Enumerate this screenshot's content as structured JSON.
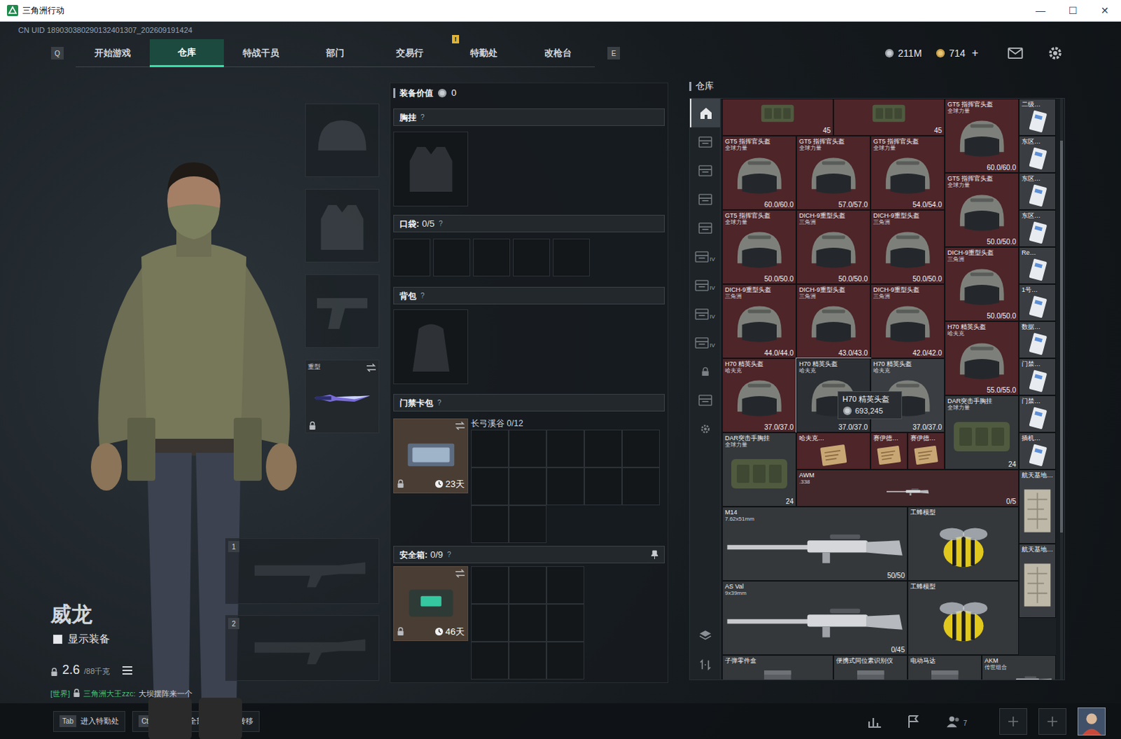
{
  "window": {
    "title": "三角洲行动",
    "controls": [
      "—",
      "☐",
      "✕"
    ]
  },
  "uid": "CN UID 189030380290132401307_202609191424",
  "nav": {
    "prev_key": "Q",
    "next_key": "E",
    "tabs": [
      {
        "label": "开始游戏",
        "selected": false,
        "badge": ""
      },
      {
        "label": "仓库",
        "selected": true,
        "badge": ""
      },
      {
        "label": "特战干员",
        "selected": false,
        "badge": ""
      },
      {
        "label": "部门",
        "selected": false,
        "badge": ""
      },
      {
        "label": "交易行",
        "selected": false,
        "badge": ""
      },
      {
        "label": "特勤处",
        "selected": false,
        "badge": "!"
      },
      {
        "label": "改枪台",
        "selected": false,
        "badge": ""
      }
    ]
  },
  "currency": {
    "coins": "211M",
    "tokens": "714",
    "add": "+"
  },
  "character": {
    "name": "威龙",
    "show_gear": {
      "label": "显示装备",
      "checked": false
    },
    "weight": "2.6",
    "capacity": "/88千克"
  },
  "chat": {
    "channel": "[世界]",
    "sender": "三角洲大王zzc:",
    "message": "大坝摆阵来一个"
  },
  "gear_slots": [
    {
      "kind": "helmet",
      "label": "",
      "filled": false,
      "locked": false
    },
    {
      "kind": "armor",
      "label": "",
      "filled": false,
      "locked": false
    },
    {
      "kind": "pistol",
      "label": "",
      "filled": false,
      "locked": false
    },
    {
      "kind": "melee",
      "label": "重型",
      "filled": true,
      "locked": true
    }
  ],
  "weapon_slots": [
    {
      "number": "1"
    },
    {
      "number": "2"
    }
  ],
  "loadout": {
    "value_label": "装备价值",
    "value": "0",
    "chest": {
      "title": "胸挂",
      "help": "?"
    },
    "pockets": {
      "title": "口袋:",
      "count": "0/5",
      "help": "?",
      "cells": 5
    },
    "backpack": {
      "title": "背包",
      "help": "?"
    },
    "keycard": {
      "title": "门禁卡包",
      "help": "?",
      "days": "23天",
      "locked": true,
      "map": "长弓溪谷",
      "count": "0/12",
      "cells": 12
    },
    "safebox": {
      "title": "安全箱:",
      "count": "0/9",
      "help": "?",
      "days": "46天",
      "locked": true,
      "cells": 9
    }
  },
  "warehouse": {
    "title": "仓库",
    "side_tabs": [
      {
        "kind": "home",
        "tier": "",
        "selected": true
      },
      {
        "kind": "cabinet",
        "tier": "",
        "selected": false
      },
      {
        "kind": "cabinet",
        "tier": "",
        "selected": false
      },
      {
        "kind": "cabinet",
        "tier": "",
        "selected": false
      },
      {
        "kind": "cabinet",
        "tier": "",
        "selected": false
      },
      {
        "kind": "cabinet",
        "tier": "IV",
        "selected": false
      },
      {
        "kind": "cabinet",
        "tier": "IV",
        "selected": false
      },
      {
        "kind": "cabinet",
        "tier": "IV",
        "selected": false
      },
      {
        "kind": "cabinet",
        "tier": "IV",
        "selected": false
      },
      {
        "kind": "lock",
        "tier": "",
        "selected": false
      },
      {
        "kind": "cabinet",
        "tier": "",
        "selected": false
      },
      {
        "kind": "gear",
        "tier": "",
        "selected": false
      }
    ],
    "items": [
      {
        "kind": "rig",
        "name": "",
        "sub": "",
        "value": "45",
        "color": "#4e2529",
        "hovered": false
      },
      {
        "kind": "rig",
        "name": "",
        "sub": "",
        "value": "45",
        "color": "#4e2529",
        "hovered": false
      },
      {
        "kind": "helmet",
        "name": "GT5 指挥官头盔",
        "sub": "全球力量",
        "value": "60.0/60.0",
        "color": "#4e2529",
        "hovered": false
      },
      {
        "kind": "card",
        "name": "二级…",
        "sub": "",
        "value": "",
        "color": "#3a3d41",
        "hovered": false
      },
      {
        "kind": "helmet",
        "name": "GT5 指挥官头盔",
        "sub": "全球力量",
        "value": "60.0/60.0",
        "color": "#4e2529",
        "hovered": false
      },
      {
        "kind": "helmet",
        "name": "GT5 指挥官头盔",
        "sub": "全球力量",
        "value": "57.0/57.0",
        "color": "#4e2529",
        "hovered": false
      },
      {
        "kind": "helmet",
        "name": "GT5 指挥官头盔",
        "sub": "全球力量",
        "value": "54.0/54.0",
        "color": "#4e2529",
        "hovered": false
      },
      {
        "kind": "card",
        "name": "东区…",
        "sub": "",
        "value": "",
        "color": "#3a3d41",
        "hovered": false
      },
      {
        "kind": "helmet",
        "name": "GT5 指挥官头盔",
        "sub": "全球力量",
        "value": "50.0/50.0",
        "color": "#4e2529",
        "hovered": false
      },
      {
        "kind": "card",
        "name": "东区…",
        "sub": "",
        "value": "",
        "color": "#3a3d41",
        "hovered": false
      },
      {
        "kind": "helmet",
        "name": "GT5 指挥官头盔",
        "sub": "全球力量",
        "value": "50.0/50.0",
        "color": "#4e2529",
        "hovered": false
      },
      {
        "kind": "helmet",
        "name": "DICH-9重型头盔",
        "sub": "三角洲",
        "value": "50.0/50.0",
        "color": "#4e2529",
        "hovered": false
      },
      {
        "kind": "helmet",
        "name": "DICH-9重型头盔",
        "sub": "三角洲",
        "value": "50.0/50.0",
        "color": "#4e2529",
        "hovered": false
      },
      {
        "kind": "card",
        "name": "东区…",
        "sub": "",
        "value": "",
        "color": "#3a3d41",
        "hovered": false
      },
      {
        "kind": "helmet",
        "name": "DICH-9重型头盔",
        "sub": "三角洲",
        "value": "50.0/50.0",
        "color": "#4e2529",
        "hovered": false
      },
      {
        "kind": "card",
        "name": "Re…",
        "sub": "",
        "value": "",
        "color": "#3a3d41",
        "hovered": false
      },
      {
        "kind": "helmet",
        "name": "DICH-9重型头盔",
        "sub": "三角洲",
        "value": "44.0/44.0",
        "color": "#4e2529",
        "hovered": false
      },
      {
        "kind": "helmet",
        "name": "DICH-9重型头盔",
        "sub": "三角洲",
        "value": "43.0/43.0",
        "color": "#4e2529",
        "hovered": false
      },
      {
        "kind": "helmet",
        "name": "DICH-9重型头盔",
        "sub": "三角洲",
        "value": "42.0/42.0",
        "color": "#4e2529",
        "hovered": false
      },
      {
        "kind": "card",
        "name": "1号…",
        "sub": "",
        "value": "",
        "color": "#3a3d41",
        "hovered": false
      },
      {
        "kind": "helmet",
        "name": "H70 精英头盔",
        "sub": "哈夫克",
        "value": "55.0/55.0",
        "color": "#4e2529",
        "hovered": false
      },
      {
        "kind": "card",
        "name": "数据…",
        "sub": "",
        "value": "",
        "color": "#3a3d41",
        "hovered": false
      },
      {
        "kind": "helmet",
        "name": "H70 精英头盔",
        "sub": "哈夫克",
        "value": "37.0/37.0",
        "color": "#4e2529",
        "hovered": false
      },
      {
        "kind": "helmet",
        "name": "H70 精英头盔",
        "sub": "哈夫克",
        "value": "37.0/37.0",
        "color": "#2c2f33",
        "hovered": true
      },
      {
        "kind": "helmet",
        "name": "H70 精英头盔",
        "sub": "哈夫克",
        "value": "37.0/37.0",
        "color": "#3a3d41",
        "hovered": false
      },
      {
        "kind": "card",
        "name": "门禁…",
        "sub": "",
        "value": "",
        "color": "#3a3d41",
        "hovered": false
      },
      {
        "kind": "rig",
        "name": "DAR突击手胸挂",
        "sub": "全球力量",
        "value": "24",
        "color": "#34383b",
        "hovered": false
      },
      {
        "kind": "card",
        "name": "门禁…",
        "sub": "",
        "value": "",
        "color": "#3a3d41",
        "hovered": false
      },
      {
        "kind": "rig",
        "name": "DAR突击手胸挂",
        "sub": "全球力量",
        "value": "24",
        "color": "#34383b",
        "hovered": false
      },
      {
        "kind": "doc",
        "name": "哈夫克…",
        "sub": "",
        "value": "",
        "color": "#4e2529",
        "hovered": false
      },
      {
        "kind": "doc",
        "name": "赛伊德…",
        "sub": "",
        "value": "",
        "color": "#4e2529",
        "hovered": false
      },
      {
        "kind": "doc",
        "name": "赛伊德…",
        "sub": "",
        "value": "",
        "color": "#4e2529",
        "hovered": false
      },
      {
        "kind": "card",
        "name": "插机…",
        "sub": "",
        "value": "",
        "color": "#3a3d41",
        "hovered": false
      },
      {
        "kind": "rifle",
        "name": "AWM",
        "sub": ".338",
        "value": "0/5",
        "color": "#43282b",
        "hovered": false
      },
      {
        "kind": "map",
        "name": "航天基地…",
        "sub": "",
        "value": "",
        "color": "#3a3d41",
        "hovered": false
      },
      {
        "kind": "rifle",
        "name": "M14",
        "sub": "7.62x51mm",
        "value": "50/50",
        "color": "#34383b",
        "hovered": false
      },
      {
        "kind": "toy",
        "name": "工蜂模型",
        "sub": "",
        "value": "",
        "color": "#34383b",
        "hovered": false
      },
      {
        "kind": "map",
        "name": "航天基地…",
        "sub": "",
        "value": "",
        "color": "#3a3d41",
        "hovered": false
      },
      {
        "kind": "rifle",
        "name": "AS Val",
        "sub": "9x39mm",
        "value": "0/45",
        "color": "#34383b",
        "hovered": false
      },
      {
        "kind": "toy",
        "name": "工蜂模型",
        "sub": "",
        "value": "",
        "color": "#34383b",
        "hovered": false
      },
      {
        "kind": "box",
        "name": "子弹零件盒",
        "sub": "",
        "value": "",
        "color": "#34383b",
        "hovered": false
      },
      {
        "kind": "box",
        "name": "便携式同位素识别仪",
        "sub": "",
        "value": "",
        "color": "#34383b",
        "hovered": false
      },
      {
        "kind": "box",
        "name": "电动马达",
        "sub": "",
        "value": "",
        "color": "#34383b",
        "hovered": false
      },
      {
        "kind": "rifle",
        "name": "AKM",
        "sub": "传世组合",
        "value": "",
        "color": "#34383b",
        "hovered": false
      }
    ],
    "tooltip": {
      "name": "H70 精英头盔",
      "value": "693,245"
    }
  },
  "bottom_bar": {
    "hints": [
      {
        "keys": [
          "Tab"
        ],
        "label": "进入特勤处"
      },
      {
        "keys": [
          "Ctrl",
          "F"
        ],
        "label": "转移全部"
      },
      {
        "keys": [
          "F"
        ],
        "label": "转移"
      }
    ],
    "friends": "7"
  }
}
